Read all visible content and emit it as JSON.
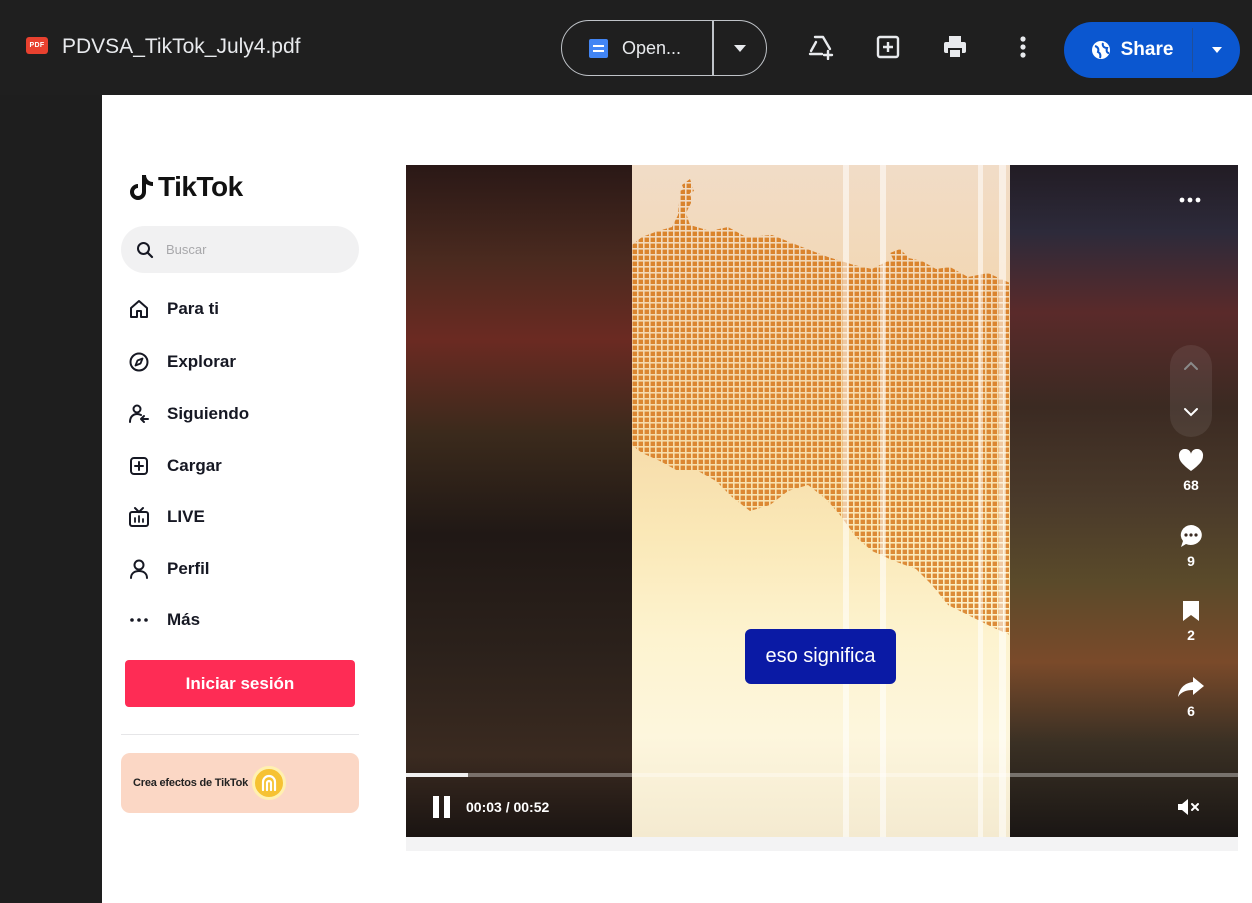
{
  "viewer": {
    "file_name": "PDVSA_TikTok_July4.pdf",
    "pdf_badge": "PDF",
    "open_label": "Open...",
    "share_label": "Share"
  },
  "sidebar": {
    "logo_text": "TikTok",
    "search_placeholder": "Buscar",
    "nav": [
      {
        "label": "Para ti",
        "icon": "home-icon"
      },
      {
        "label": "Explorar",
        "icon": "compass-icon"
      },
      {
        "label": "Siguiendo",
        "icon": "following-icon"
      },
      {
        "label": "Cargar",
        "icon": "upload-icon"
      },
      {
        "label": "LIVE",
        "icon": "live-icon"
      },
      {
        "label": "Perfil",
        "icon": "profile-icon"
      },
      {
        "label": "Más",
        "icon": "more-icon"
      }
    ],
    "login_label": "Iniciar sesión",
    "promo_text": "Crea efectos de TikTok"
  },
  "video": {
    "caption": "eso significa",
    "likes": "68",
    "comments": "9",
    "saves": "2",
    "shares": "6",
    "time": "00:03 / 00:52",
    "progress_fraction": 0.074
  },
  "colors": {
    "tiktok_red": "#fe2c55",
    "share_blue": "#0b57d0",
    "caption_blue": "#0a1aa5",
    "pdf_red": "#e8412f"
  }
}
